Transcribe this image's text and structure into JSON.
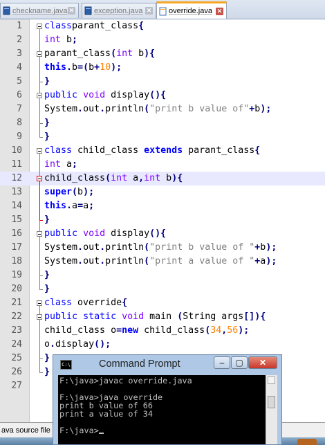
{
  "tabs": [
    {
      "label": "checkname.java",
      "active": false
    },
    {
      "label": "exception.java",
      "active": false
    },
    {
      "label": "override.java",
      "active": true
    }
  ],
  "tab_close_glyph": "✕",
  "colors": {
    "keyword": "#0000ff",
    "type_keyword": "#8000ff",
    "number": "#ff8000",
    "string": "#808080",
    "current_line": "#e8e8ff",
    "active_tab_accent": "#f6a623",
    "close_button": "#c8382a"
  },
  "editor": {
    "current_line": 12,
    "lines": [
      {
        "n": "1",
        "tokens": [
          [
            "kw",
            "class"
          ],
          [
            "",
            "parant_class"
          ],
          [
            "op",
            "{"
          ]
        ]
      },
      {
        "n": "2",
        "tokens": [
          [
            "k2",
            "int"
          ],
          [
            "",
            " b"
          ],
          [
            "op",
            ";"
          ]
        ]
      },
      {
        "n": "3",
        "tokens": [
          [
            "",
            "parant_class"
          ],
          [
            "op",
            "("
          ],
          [
            "k2",
            "int"
          ],
          [
            "",
            " b"
          ],
          [
            "op",
            ")"
          ],
          [
            "op",
            "{"
          ]
        ]
      },
      {
        "n": "4",
        "tokens": [
          [
            "kb",
            "this"
          ],
          [
            "op",
            "."
          ],
          [
            "",
            "b"
          ],
          [
            "op",
            "=("
          ],
          [
            "",
            "b"
          ],
          [
            "op",
            "+"
          ],
          [
            "num",
            "10"
          ],
          [
            "op",
            ")"
          ],
          [
            "op",
            ";"
          ]
        ]
      },
      {
        "n": "5",
        "tokens": [
          [
            "op",
            "}"
          ]
        ]
      },
      {
        "n": "6",
        "tokens": [
          [
            "kw",
            "public"
          ],
          [
            "",
            ""
          ],
          [
            "k2",
            "void"
          ],
          [
            "",
            " display"
          ],
          [
            "op",
            "()"
          ],
          [
            "op",
            "{"
          ]
        ]
      },
      {
        "n": "7",
        "tokens": [
          [
            "",
            "System"
          ],
          [
            "op",
            "."
          ],
          [
            "",
            "out"
          ],
          [
            "op",
            "."
          ],
          [
            "",
            "println"
          ],
          [
            "op",
            "("
          ],
          [
            "str",
            "\"print b value of\""
          ],
          [
            "op",
            "+"
          ],
          [
            "",
            "b"
          ],
          [
            "op",
            ")"
          ],
          [
            "op",
            ";"
          ]
        ]
      },
      {
        "n": "8",
        "tokens": [
          [
            "op",
            "}"
          ]
        ]
      },
      {
        "n": "9",
        "tokens": [
          [
            "op",
            "}"
          ]
        ]
      },
      {
        "n": "10",
        "tokens": [
          [
            "kw",
            "class"
          ],
          [
            "",
            " child_class "
          ],
          [
            "kb",
            "extends"
          ],
          [
            "",
            " parant_class"
          ],
          [
            "op",
            "{"
          ]
        ]
      },
      {
        "n": "11",
        "tokens": [
          [
            "k2",
            "int"
          ],
          [
            "",
            " a"
          ],
          [
            "op",
            ";"
          ]
        ]
      },
      {
        "n": "12",
        "tokens": [
          [
            "",
            "child_class"
          ],
          [
            "op",
            "("
          ],
          [
            "k2",
            "int"
          ],
          [
            "",
            " a"
          ],
          [
            "op",
            ","
          ],
          [
            "k2",
            "int"
          ],
          [
            "",
            " b"
          ],
          [
            "op",
            ")"
          ],
          [
            "op",
            "{"
          ]
        ]
      },
      {
        "n": "13",
        "tokens": [
          [
            "kb",
            "super"
          ],
          [
            "op",
            "("
          ],
          [
            "",
            "b"
          ],
          [
            "op",
            ")"
          ],
          [
            "op",
            ";"
          ]
        ]
      },
      {
        "n": "14",
        "tokens": [
          [
            "kb",
            "this"
          ],
          [
            "op",
            "."
          ],
          [
            "",
            "a"
          ],
          [
            "op",
            "="
          ],
          [
            "",
            "a"
          ],
          [
            "op",
            ";"
          ]
        ]
      },
      {
        "n": "15",
        "tokens": [
          [
            "op",
            "}"
          ]
        ]
      },
      {
        "n": "16",
        "tokens": [
          [
            "kw",
            "public"
          ],
          [
            "",
            ""
          ],
          [
            "k2",
            "void"
          ],
          [
            "",
            " display"
          ],
          [
            "op",
            "()"
          ],
          [
            "op",
            "{"
          ]
        ]
      },
      {
        "n": "17",
        "tokens": [
          [
            "",
            "System"
          ],
          [
            "op",
            "."
          ],
          [
            "",
            "out"
          ],
          [
            "op",
            "."
          ],
          [
            "",
            "println"
          ],
          [
            "op",
            "("
          ],
          [
            "str",
            "\"print b value of \""
          ],
          [
            "op",
            "+"
          ],
          [
            "",
            "b"
          ],
          [
            "op",
            ")"
          ],
          [
            "op",
            ";"
          ]
        ]
      },
      {
        "n": "18",
        "tokens": [
          [
            "",
            "System"
          ],
          [
            "op",
            "."
          ],
          [
            "",
            "out"
          ],
          [
            "op",
            "."
          ],
          [
            "",
            "println"
          ],
          [
            "op",
            "("
          ],
          [
            "str",
            "\"print a value of \""
          ],
          [
            "op",
            "+"
          ],
          [
            "",
            "a"
          ],
          [
            "op",
            ")"
          ],
          [
            "op",
            ";"
          ]
        ]
      },
      {
        "n": "19",
        "tokens": [
          [
            "op",
            "}"
          ]
        ]
      },
      {
        "n": "20",
        "tokens": [
          [
            "op",
            "}"
          ]
        ]
      },
      {
        "n": "21",
        "tokens": [
          [
            "kw",
            "class"
          ],
          [
            "",
            " override"
          ],
          [
            "op",
            "{"
          ]
        ]
      },
      {
        "n": "22",
        "tokens": [
          [
            "kw",
            "public"
          ],
          [
            "",
            ""
          ],
          [
            "kw",
            "static"
          ],
          [
            "",
            ""
          ],
          [
            "k2",
            "void"
          ],
          [
            "",
            " main "
          ],
          [
            "op",
            "("
          ],
          [
            "",
            "String args"
          ],
          [
            "op",
            "[])"
          ],
          [
            "op",
            "{"
          ]
        ]
      },
      {
        "n": "23",
        "tokens": [
          [
            "",
            "child_class o"
          ],
          [
            "op",
            "="
          ],
          [
            "kb",
            "new"
          ],
          [
            "",
            " child_class"
          ],
          [
            "op",
            "("
          ],
          [
            "num",
            "34"
          ],
          [
            "op",
            ","
          ],
          [
            "num",
            "56"
          ],
          [
            "op",
            ")"
          ],
          [
            "op",
            ";"
          ]
        ]
      },
      {
        "n": "24",
        "tokens": [
          [
            "",
            "o"
          ],
          [
            "op",
            "."
          ],
          [
            "",
            "display"
          ],
          [
            "op",
            "()"
          ],
          [
            "op",
            ";"
          ]
        ]
      },
      {
        "n": "25",
        "tokens": [
          [
            "op",
            "}"
          ]
        ]
      },
      {
        "n": "26",
        "tokens": [
          [
            "op",
            "}"
          ]
        ]
      },
      {
        "n": "27",
        "tokens": []
      }
    ]
  },
  "status_bar": {
    "text": "ava source file"
  },
  "cmd_window": {
    "title": "Command Prompt",
    "icon": "C:\\",
    "buttons": {
      "minimize": "–",
      "maximize": "▢",
      "close": "✕"
    },
    "console_lines": [
      "F:\\java>javac override.java",
      "",
      "F:\\java>java override",
      "print b value of 66",
      "print a value of 34",
      "",
      "F:\\java>"
    ]
  }
}
